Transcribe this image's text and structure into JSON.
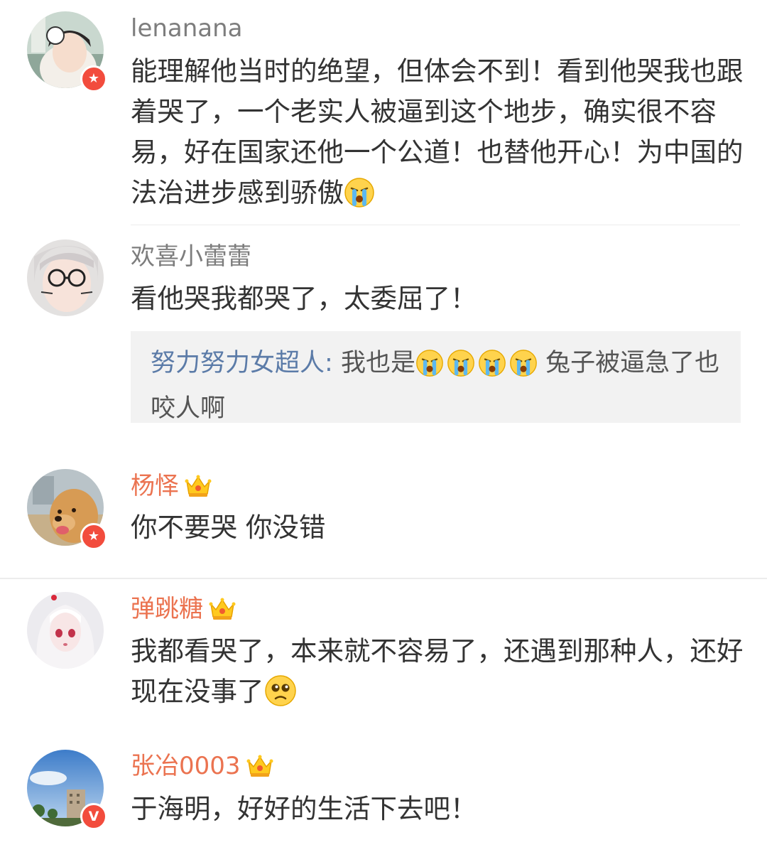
{
  "comments": [
    {
      "username": "lenanana",
      "text": "能理解他当时的绝望，但体会不到！看到他哭我也跟着哭了，一个老实人被逼到这个地步，确实很不容易，好在国家还他一个公道！也替他开心！为中国的法治进步感到骄傲",
      "trailing_emoji": "crying-emoji",
      "badge": "red-star-badge"
    },
    {
      "username": "欢喜小蕾蕾",
      "text": "看他哭我都哭了，太委屈了！",
      "reply": {
        "username": "努力努力女超人",
        "separator": ":",
        "text_before": "我也是",
        "emojis": [
          "crying-emoji",
          "crying-emoji",
          "crying-emoji",
          "crying-emoji"
        ],
        "text_after": "兔子被逼急了也咬人啊"
      }
    },
    {
      "username": "杨怿",
      "text": "你不要哭 你没错",
      "badge": "red-star-badge",
      "crown_icon": "vip-crown-icon"
    },
    {
      "username": "弹跳糖",
      "text": "我都看哭了，本来就不容易了，还遇到那种人，还好现在没事了",
      "trailing_emoji": "sad-emoji",
      "crown_icon": "vip-crown-icon"
    },
    {
      "username": "张冶0003",
      "text": "于海明，好好的生活下去吧！",
      "badge": "verified-v-badge",
      "badge_text": "V",
      "crown_icon": "vip-crown-icon"
    }
  ],
  "colors": {
    "username_gray": "#7d7d7d",
    "username_vip": "#eb7350",
    "reply_user": "#5b7ba8",
    "badge_red": "#f24c3d"
  }
}
